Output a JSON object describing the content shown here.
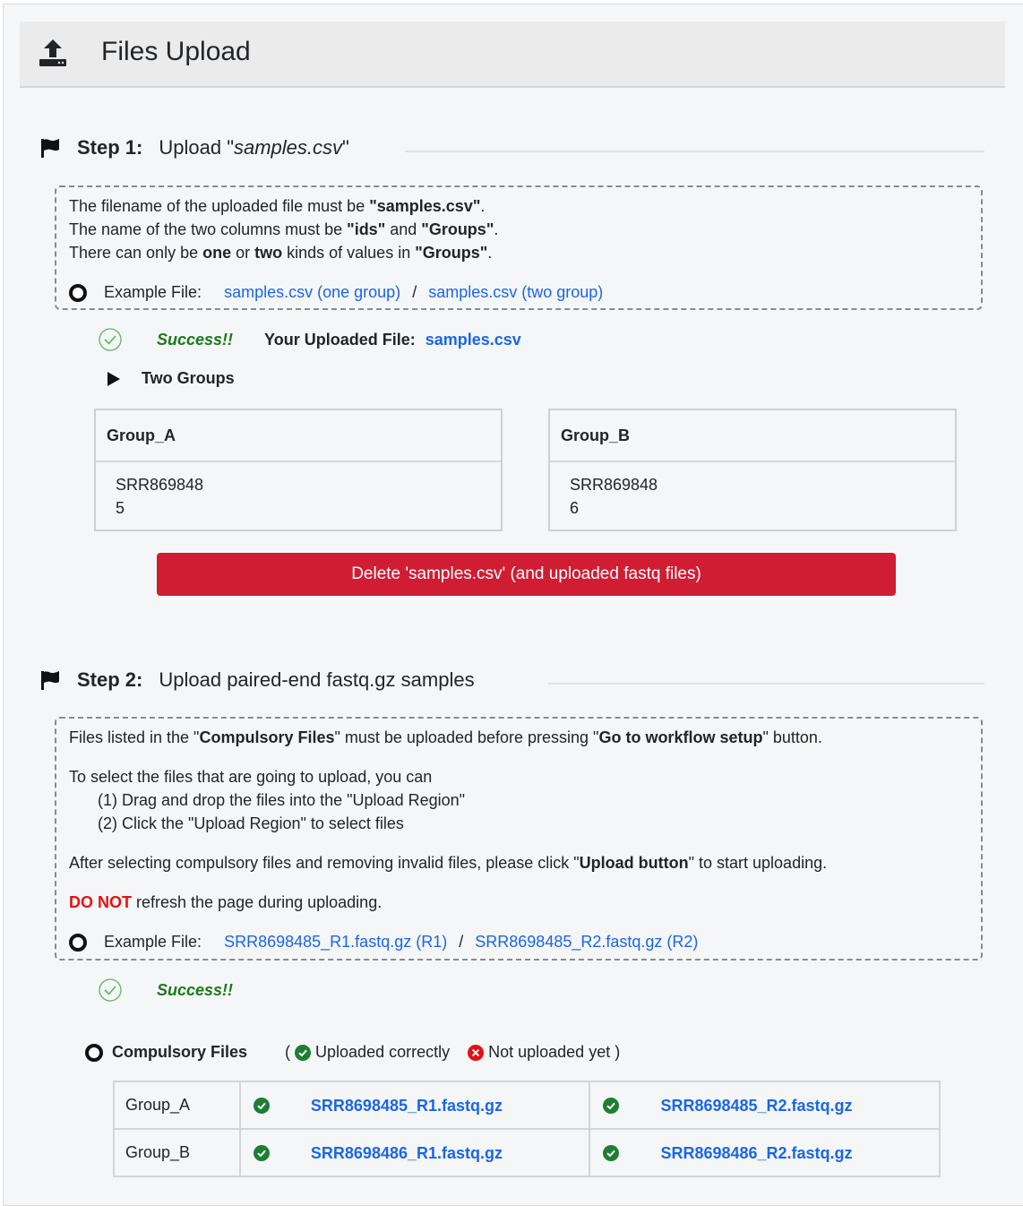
{
  "header": {
    "title": "Files Upload",
    "icon": "upload-icon"
  },
  "step1": {
    "num": "Step 1:",
    "title_pre": "Upload \"",
    "title_em": "samples.csv",
    "title_post": "\"",
    "info": {
      "l1_a": "The filename of the uploaded file must be ",
      "l1_b": "\"samples.csv\"",
      "l1_c": ".",
      "l2_a": "The name of the two columns must be ",
      "l2_b": "\"ids\"",
      "l2_c": " and ",
      "l2_d": "\"Groups\"",
      "l2_e": ".",
      "l3_a": "There can only be ",
      "l3_b": "one",
      "l3_c": " or ",
      "l3_d": "two",
      "l3_e": " kinds of values in ",
      "l3_f": "\"Groups\"",
      "l3_g": "."
    },
    "example_label": "Example File:",
    "example_one": "samples.csv (one group)",
    "example_sep": "/",
    "example_two": "samples.csv (two group)",
    "success": "Success!!",
    "uploaded_label": "Your Uploaded File:",
    "uploaded_file": "samples.csv",
    "groups_toggle": "Two Groups",
    "group_a": {
      "title": "Group_A",
      "line1": "SRR869848",
      "line2": "5"
    },
    "group_b": {
      "title": "Group_B",
      "line1": "SRR869848",
      "line2": "6"
    },
    "delete_button": "Delete 'samples.csv' (and uploaded fastq files)"
  },
  "step2": {
    "num": "Step 2:",
    "title": "Upload paired-end fastq.gz samples",
    "info": {
      "l1_a": "Files listed in the \"",
      "l1_b": "Compulsory Files",
      "l1_c": "\" must be uploaded before pressing \"",
      "l1_d": "Go to workflow setup",
      "l1_e": "\" button.",
      "l2": "To select the files that are going to upload, you can",
      "l3": "(1) Drag and drop the files into the \"Upload Region\"",
      "l4": "(2) Click the \"Upload Region\" to select files",
      "l5_a": "After selecting compulsory files and removing invalid files, please click \"",
      "l5_b": "Upload button",
      "l5_c": "\" to start uploading.",
      "l6_a": "DO NOT",
      "l6_b": " refresh the page during uploading."
    },
    "example_label": "Example File:",
    "example_r1": "SRR8698485_R1.fastq.gz (R1)",
    "example_sep": "/",
    "example_r2": "SRR8698485_R2.fastq.gz (R2)",
    "success": "Success!!"
  },
  "compulsory": {
    "label": "Compulsory Files",
    "legend_open": "(",
    "legend_ok": "Uploaded correctly",
    "legend_no": "Not uploaded yet",
    "legend_close": ")",
    "rows": [
      {
        "group": "Group_A",
        "r1": "SRR8698485_R1.fastq.gz",
        "r2": "SRR8698485_R2.fastq.gz"
      },
      {
        "group": "Group_B",
        "r1": "SRR8698486_R1.fastq.gz",
        "r2": "SRR8698486_R2.fastq.gz"
      }
    ]
  },
  "colors": {
    "accent": "#1a66e8",
    "danger": "#d01d33",
    "success": "#1a7a1a",
    "check": "#1e7e34",
    "error": "#e31212"
  }
}
